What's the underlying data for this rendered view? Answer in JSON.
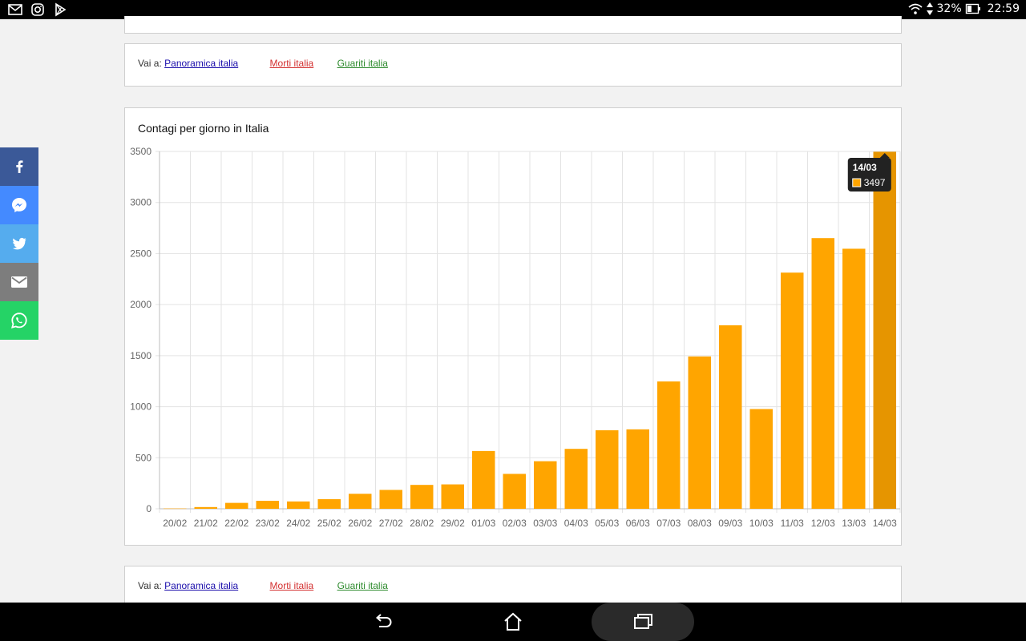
{
  "status_bar": {
    "battery": "32%",
    "time": "22:59"
  },
  "nav_links": {
    "prefix": "Vai a:",
    "overview": "Panoramica italia",
    "deaths": "Morti italia",
    "recovered": "Guariti italia"
  },
  "chart": {
    "title": "Contagi per giorno in Italia"
  },
  "chart_data": {
    "type": "bar",
    "title": "Contagi per giorno in Italia",
    "xlabel": "",
    "ylabel": "",
    "ylim": [
      0,
      3500
    ],
    "yticks": [
      0,
      500,
      1000,
      1500,
      2000,
      2500,
      3000,
      3500
    ],
    "grid": true,
    "categories": [
      "20/02",
      "21/02",
      "22/02",
      "23/02",
      "24/02",
      "25/02",
      "26/02",
      "27/02",
      "28/02",
      "29/02",
      "01/03",
      "02/03",
      "03/03",
      "04/03",
      "05/03",
      "06/03",
      "07/03",
      "08/03",
      "09/03",
      "10/03",
      "11/03",
      "12/03",
      "13/03",
      "14/03"
    ],
    "values": [
      3,
      17,
      58,
      78,
      72,
      94,
      147,
      185,
      234,
      239,
      566,
      342,
      466,
      587,
      769,
      778,
      1247,
      1492,
      1797,
      977,
      2313,
      2651,
      2547,
      3497
    ],
    "bar_color": "#ffa500",
    "highlight_color": "#e69500",
    "tooltip": {
      "category": "14/03",
      "value": "3497"
    }
  },
  "colors": {
    "facebook": "#3b5998",
    "messenger": "#448aff",
    "twitter": "#55acee",
    "email": "#7d7d7d",
    "whatsapp": "#25d366"
  },
  "share_bar": [
    {
      "icon": "facebook-icon"
    },
    {
      "icon": "messenger-icon"
    },
    {
      "icon": "twitter-icon"
    },
    {
      "icon": "email-icon"
    },
    {
      "icon": "whatsapp-icon"
    }
  ]
}
